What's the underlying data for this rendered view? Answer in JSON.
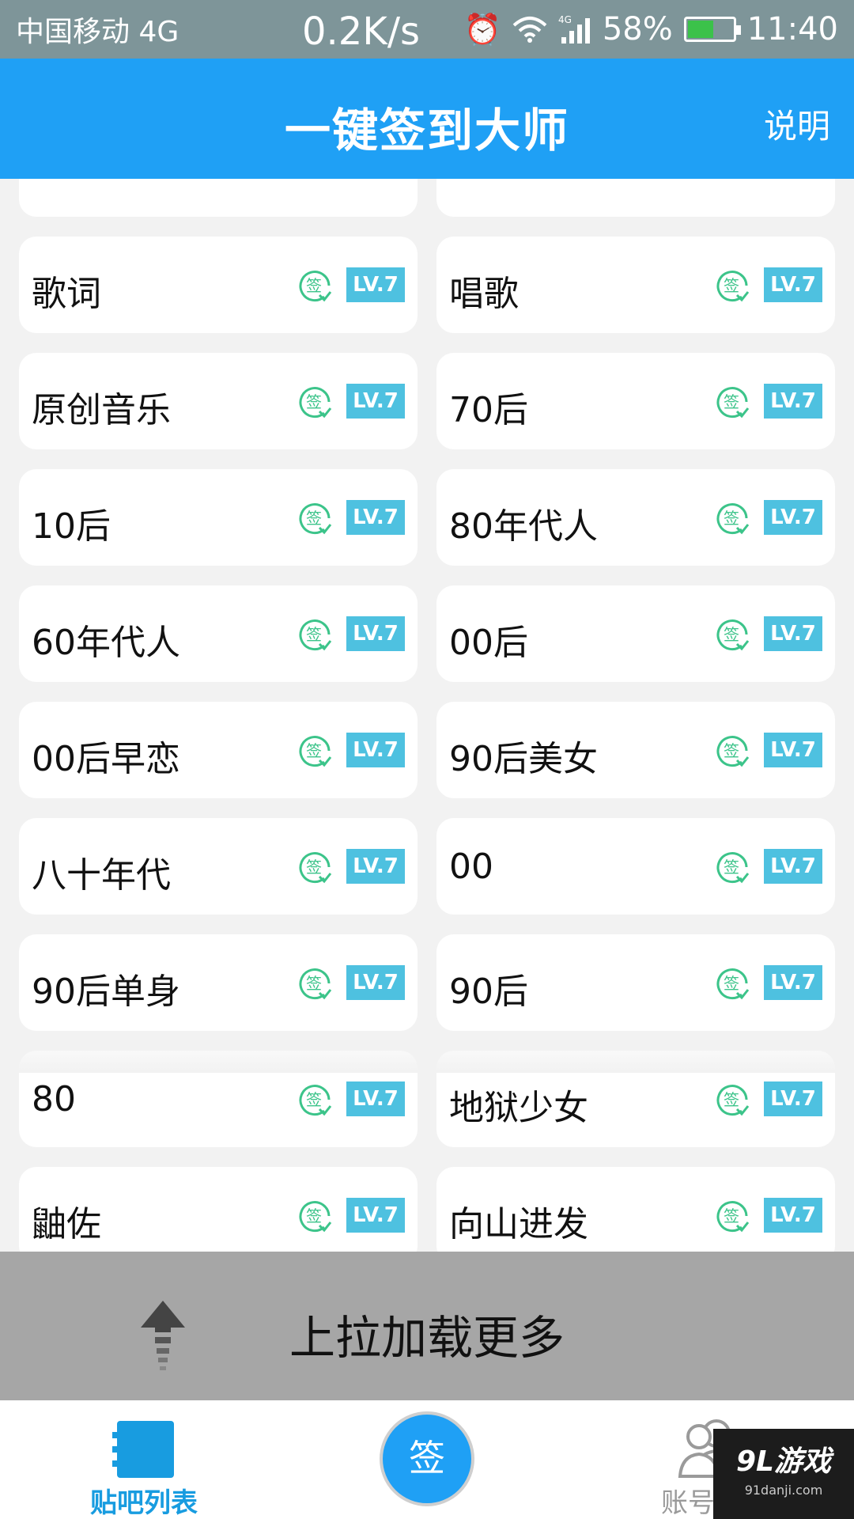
{
  "status_bar": {
    "carrier": "中国移动 4G",
    "speed": "0.2K/s",
    "network_badge": "4G",
    "battery": "58%",
    "battery_level": 0.58,
    "time": "11:40",
    "icons": [
      "alarm-icon",
      "wifi-icon",
      "signal-icon",
      "battery-icon"
    ]
  },
  "header": {
    "title": "一键签到大师",
    "help": "说明"
  },
  "sign_icon_label": "签",
  "colors": {
    "header_blue": "#1fa0f5",
    "sign_green": "#3cc48a",
    "level_badge": "#4ec1e0",
    "load_bar": "#a6a6a6"
  },
  "forums": [
    {
      "name": "",
      "level": ""
    },
    {
      "name": "",
      "level": ""
    },
    {
      "name": "歌词",
      "level": "LV.7"
    },
    {
      "name": "唱歌",
      "level": "LV.7"
    },
    {
      "name": "原创音乐",
      "level": "LV.7"
    },
    {
      "name": "70后",
      "level": "LV.7"
    },
    {
      "name": "10后",
      "level": "LV.7"
    },
    {
      "name": "80年代人",
      "level": "LV.7"
    },
    {
      "name": "60年代人",
      "level": "LV.7"
    },
    {
      "name": "00后",
      "level": "LV.7"
    },
    {
      "name": "00后早恋",
      "level": "LV.7"
    },
    {
      "name": "90后美女",
      "level": "LV.7"
    },
    {
      "name": "八十年代",
      "level": "LV.7"
    },
    {
      "name": "00",
      "level": "LV.7"
    },
    {
      "name": "90后单身",
      "level": "LV.7"
    },
    {
      "name": "90后",
      "level": "LV.7"
    },
    {
      "name": "80",
      "level": "LV.7"
    },
    {
      "name": "地狱少女",
      "level": "LV.7"
    },
    {
      "name": "鼬佐",
      "level": "LV.7"
    },
    {
      "name": "向山进发",
      "level": "LV.7"
    }
  ],
  "load_more": {
    "text": "上拉加载更多"
  },
  "tabbar": {
    "forum_list": "贴吧列表",
    "sign_button": "签",
    "account": "账号管"
  },
  "watermark": {
    "main": "9L游戏",
    "sub": "91danji.com"
  }
}
